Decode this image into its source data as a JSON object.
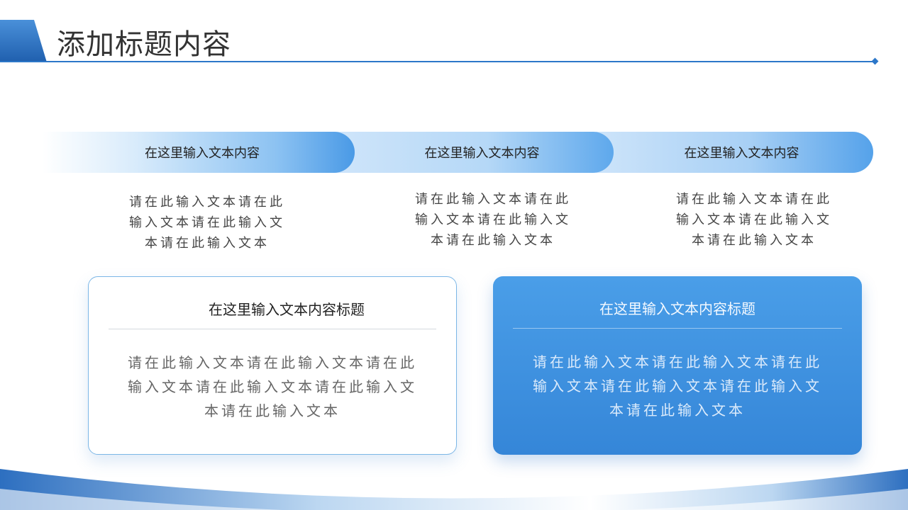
{
  "header": {
    "title": "添加标题内容"
  },
  "banners": [
    {
      "label": "在这里输入文本内容"
    },
    {
      "label": "在这里输入文本内容"
    },
    {
      "label": "在这里输入文本内容"
    }
  ],
  "columns": [
    {
      "lines": [
        "请在此输入文本请在此",
        "输入文本请在此输入文",
        "本请在此输入文本"
      ]
    },
    {
      "lines": [
        "请在此输入文本请在此",
        "输入文本请在此输入文",
        "本请在此输入文本"
      ]
    },
    {
      "lines": [
        "请在此输入文本请在此",
        "输入文本请在此输入文",
        "本请在此输入文本"
      ]
    }
  ],
  "cards": [
    {
      "title": "在这里输入文本内容标题",
      "lines": [
        "请在此输入文本请在此输入文本请在此",
        "输入文本请在此输入文本请在此输入文",
        "本请在此输入文本"
      ]
    },
    {
      "title": "在这里输入文本内容标题",
      "lines": [
        "请在此输入文本请在此输入文本请在此",
        "输入文本请在此输入文本请在此输入文",
        "本请在此输入文本"
      ]
    }
  ],
  "colors": {
    "accent": "#2c77c9",
    "card_fill": "#3f94e2",
    "banner_end": "#4a9ae6"
  }
}
